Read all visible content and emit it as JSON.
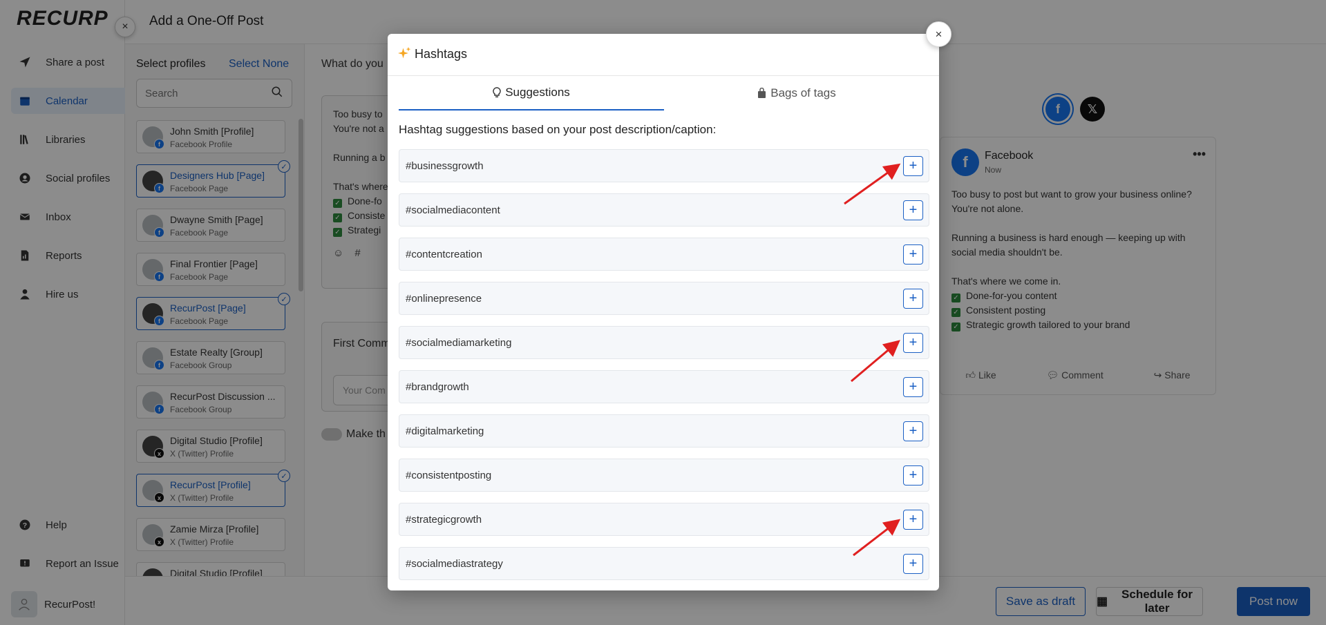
{
  "app": {
    "logo": "RECURP"
  },
  "nav": {
    "items": [
      {
        "label": "Share a post",
        "icon": "send-icon"
      },
      {
        "label": "Calendar",
        "icon": "calendar-icon",
        "active": true
      },
      {
        "label": "Libraries",
        "icon": "library-icon"
      },
      {
        "label": "Social profiles",
        "icon": "user-circle-icon"
      },
      {
        "label": "Inbox",
        "icon": "inbox-icon"
      },
      {
        "label": "Reports",
        "icon": "report-icon"
      },
      {
        "label": "Hire us",
        "icon": "person-icon"
      }
    ],
    "bottom": [
      {
        "label": "Help",
        "icon": "help-icon"
      },
      {
        "label": "Report an Issue",
        "icon": "flag-icon"
      }
    ],
    "user": "RecurPost!"
  },
  "panel": {
    "title": "Add a One-Off Post",
    "select_profiles": "Select profiles",
    "select_none": "Select None",
    "search_placeholder": "Search",
    "profiles": [
      {
        "name": "John Smith [Profile]",
        "type": "Facebook Profile",
        "net": "fb",
        "selected": false
      },
      {
        "name": "Designers Hub [Page]",
        "type": "Facebook Page",
        "net": "fb",
        "selected": true
      },
      {
        "name": "Dwayne Smith [Page]",
        "type": "Facebook Page",
        "net": "fb",
        "selected": false
      },
      {
        "name": "Final Frontier [Page]",
        "type": "Facebook Page",
        "net": "fb",
        "selected": false
      },
      {
        "name": "RecurPost [Page]",
        "type": "Facebook Page",
        "net": "fb",
        "selected": true
      },
      {
        "name": "Estate Realty [Group]",
        "type": "Facebook Group",
        "net": "fb",
        "selected": false
      },
      {
        "name": "RecurPost Discussion ...",
        "type": "Facebook Group",
        "net": "fb",
        "selected": false
      },
      {
        "name": "Digital Studio [Profile]",
        "type": "X (Twitter) Profile",
        "net": "x",
        "selected": false
      },
      {
        "name": "RecurPost [Profile]",
        "type": "X (Twitter) Profile",
        "net": "x",
        "selected": true
      },
      {
        "name": "Zamie Mirza [Profile]",
        "type": "X (Twitter) Profile",
        "net": "x",
        "selected": false
      },
      {
        "name": "Digital Studio [Profile]",
        "type": "",
        "net": "x",
        "selected": false
      }
    ],
    "what_label": "What do you",
    "editor_lines": [
      "Too busy to",
      "You're not a",
      "",
      "Running a b",
      "",
      "That's where",
      "Done-fo",
      "Consiste",
      "Strategi"
    ],
    "first_comment": "First Comm",
    "comment_placeholder": "Your Com",
    "make_label": "Make th",
    "buttons": {
      "save_draft": "Save as draft",
      "schedule": "Schedule for later",
      "post_now": "Post now"
    }
  },
  "preview": {
    "network": "Facebook",
    "time": "Now",
    "body": [
      "Too busy to post but want to grow your business online?",
      "You're not alone.",
      "",
      "Running a business is hard enough — keeping up with social media shouldn't be.",
      "",
      "That's where we come in."
    ],
    "checks": [
      "Done-for-you content",
      "Consistent posting",
      "Strategic growth tailored to your brand"
    ],
    "actions": [
      "Like",
      "Comment",
      "Share"
    ]
  },
  "modal": {
    "title": "Hashtags",
    "tabs": [
      {
        "label": "Suggestions",
        "icon": "lightbulb-icon",
        "active": true
      },
      {
        "label": "Bags of tags",
        "icon": "bag-icon",
        "active": false
      }
    ],
    "heading": "Hashtag suggestions based on your post description/caption:",
    "add_symbol": "+",
    "close_symbol": "×",
    "hashtags": [
      "#businessgrowth",
      "#socialmediacontent",
      "#contentcreation",
      "#onlinepresence",
      "#socialmediamarketing",
      "#brandgrowth",
      "#digitalmarketing",
      "#consistentposting",
      "#strategicgrowth",
      "#socialmediastrategy"
    ]
  },
  "colors": {
    "accent": "#1a5fc4",
    "annotation_arrow": "#e02020",
    "facebook": "#1877f2"
  }
}
